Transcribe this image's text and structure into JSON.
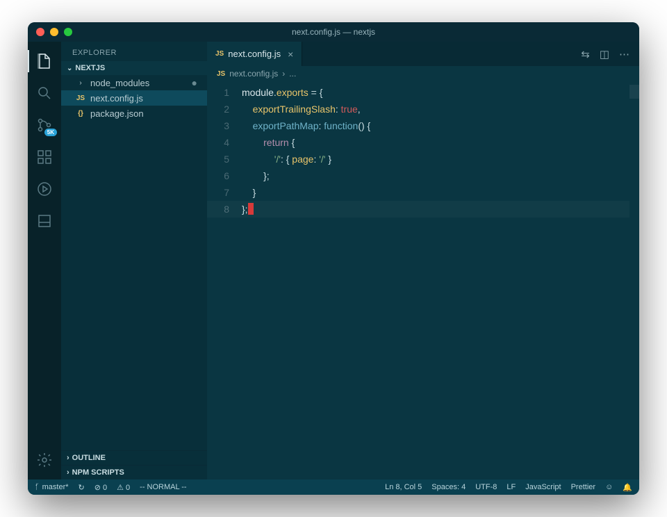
{
  "window_title": "next.config.js — nextjs",
  "sidebar": {
    "title": "EXPLORER",
    "project": "NEXTJS",
    "items": [
      {
        "icon": ">",
        "label": "node_modules",
        "modified": true
      },
      {
        "icon": "JS",
        "label": "next.config.js",
        "selected": true
      },
      {
        "icon": "{}",
        "label": "package.json"
      }
    ],
    "sections": [
      "OUTLINE",
      "NPM SCRIPTS"
    ]
  },
  "activity_badge": "5K",
  "tab": {
    "label": "next.config.js"
  },
  "breadcrumb": {
    "file": "next.config.js",
    "sep": "›",
    "rest": "..."
  },
  "code": {
    "lines": [
      "1",
      "2",
      "3",
      "4",
      "5",
      "6",
      "7",
      "8"
    ]
  },
  "status": {
    "branch": "master*",
    "sync": "↻",
    "errors": "⊘ 0",
    "warnings": "⚠ 0",
    "vim": "-- NORMAL --",
    "position": "Ln 8, Col 5",
    "spaces": "Spaces: 4",
    "encoding": "UTF-8",
    "eol": "LF",
    "language": "JavaScript",
    "formatter": "Prettier",
    "feedback": "☺",
    "bell": "🔔"
  }
}
